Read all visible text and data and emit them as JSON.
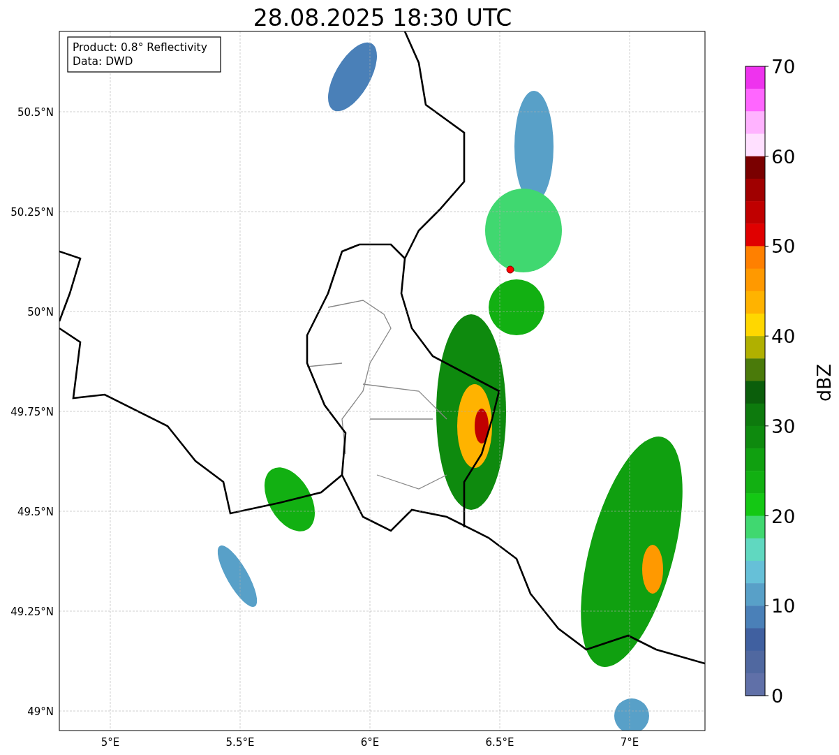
{
  "title": "28.08.2025 18:30 UTC",
  "info_box": {
    "lines": [
      "Product: 0.8° Reflectivity",
      "Data: DWD"
    ]
  },
  "map": {
    "y_ticks": [
      "50.5°N",
      "50.25°N",
      "50°N",
      "49.75°N",
      "49.5°N",
      "49.25°N",
      "49°N"
    ],
    "x_ticks": [
      "5°E",
      "5.5°E",
      "6°E",
      "6.5°E",
      "7°E"
    ]
  },
  "colorbar": {
    "label": "dBZ",
    "ticks": [
      "70",
      "60",
      "50",
      "40",
      "30",
      "20",
      "10",
      "0"
    ]
  }
}
